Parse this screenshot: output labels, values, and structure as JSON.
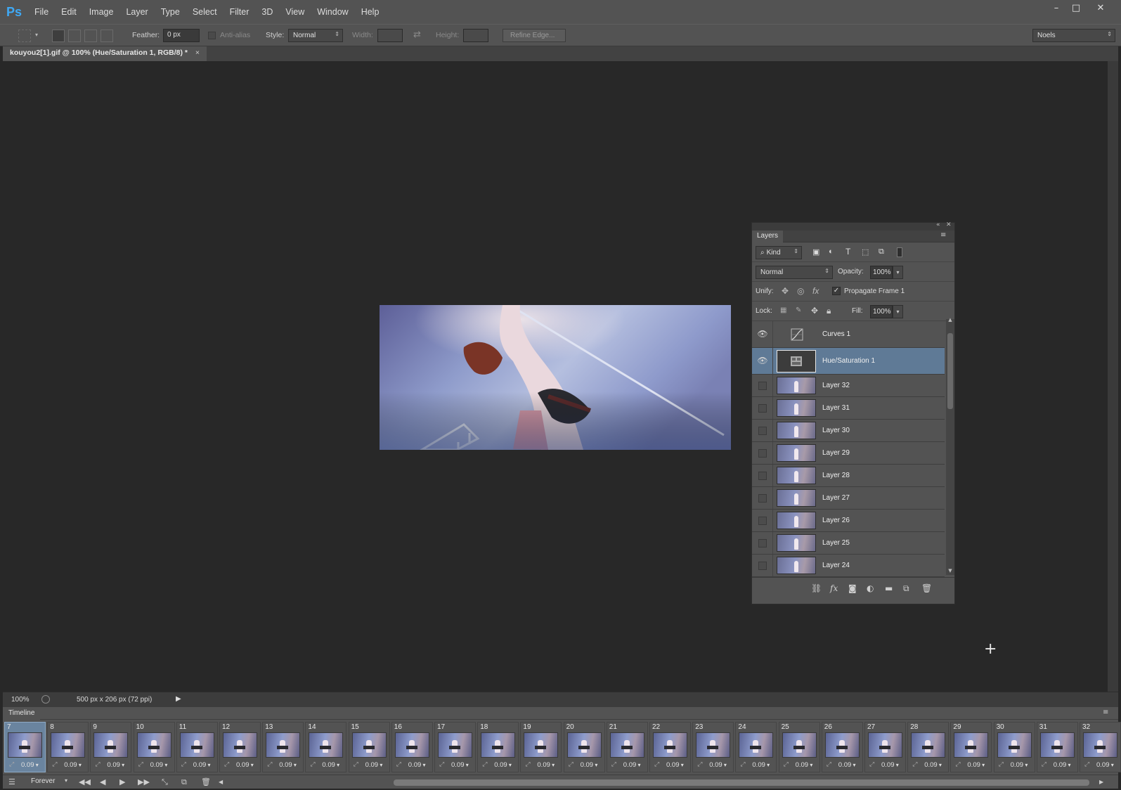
{
  "app": {
    "logo": "Ps"
  },
  "menu": [
    "File",
    "Edit",
    "Image",
    "Layer",
    "Type",
    "Select",
    "Filter",
    "3D",
    "View",
    "Window",
    "Help"
  ],
  "window_controls": {
    "minimize": "–",
    "maximize": "□",
    "close": "✕"
  },
  "options": {
    "feather_label": "Feather:",
    "feather_value": "0 px",
    "antialias_label": "Anti-alias",
    "style_label": "Style:",
    "style_value": "Normal",
    "width_label": "Width:",
    "height_label": "Height:",
    "refine_label": "Refine Edge...",
    "workspace_value": "Noels"
  },
  "document_tab": {
    "title": "kouyou2[1].gif @ 100% (Hue/Saturation 1, RGB/8) *",
    "close": "×"
  },
  "status": {
    "zoom": "100%",
    "doc_info": "500 px x 206 px (72 ppi)"
  },
  "layers_panel": {
    "tab": "Layers",
    "kind_label": "Kind",
    "blend_mode": "Normal",
    "opacity_label": "Opacity:",
    "opacity_value": "100%",
    "unify_label": "Unify:",
    "propagate_label": "Propagate Frame 1",
    "propagate_checked": true,
    "lock_label": "Lock:",
    "fill_label": "Fill:",
    "fill_value": "100%",
    "layers": [
      {
        "name": "Curves 1",
        "visible": true,
        "type": "curves-adjustment",
        "selected": false
      },
      {
        "name": "Hue/Saturation 1",
        "visible": true,
        "type": "hue-saturation-adjustment",
        "selected": true
      },
      {
        "name": "Layer 32",
        "visible": false,
        "type": "pixel",
        "selected": false
      },
      {
        "name": "Layer 31",
        "visible": false,
        "type": "pixel",
        "selected": false
      },
      {
        "name": "Layer 30",
        "visible": false,
        "type": "pixel",
        "selected": false
      },
      {
        "name": "Layer 29",
        "visible": false,
        "type": "pixel",
        "selected": false
      },
      {
        "name": "Layer 28",
        "visible": false,
        "type": "pixel",
        "selected": false
      },
      {
        "name": "Layer 27",
        "visible": false,
        "type": "pixel",
        "selected": false
      },
      {
        "name": "Layer 26",
        "visible": false,
        "type": "pixel",
        "selected": false
      },
      {
        "name": "Layer 25",
        "visible": false,
        "type": "pixel",
        "selected": false
      },
      {
        "name": "Layer 24",
        "visible": false,
        "type": "pixel",
        "selected": false
      }
    ]
  },
  "timeline": {
    "title": "Timeline",
    "loop_value": "Forever",
    "frames": [
      {
        "number": "7",
        "delay": "0.09",
        "selected": true
      },
      {
        "number": "8",
        "delay": "0.09"
      },
      {
        "number": "9",
        "delay": "0.09"
      },
      {
        "number": "10",
        "delay": "0.09"
      },
      {
        "number": "11",
        "delay": "0.09"
      },
      {
        "number": "12",
        "delay": "0.09"
      },
      {
        "number": "13",
        "delay": "0.09"
      },
      {
        "number": "14",
        "delay": "0.09"
      },
      {
        "number": "15",
        "delay": "0.09"
      },
      {
        "number": "16",
        "delay": "0.09"
      },
      {
        "number": "17",
        "delay": "0.09"
      },
      {
        "number": "18",
        "delay": "0.09"
      },
      {
        "number": "19",
        "delay": "0.09"
      },
      {
        "number": "20",
        "delay": "0.09"
      },
      {
        "number": "21",
        "delay": "0.09"
      },
      {
        "number": "22",
        "delay": "0.09"
      },
      {
        "number": "23",
        "delay": "0.09"
      },
      {
        "number": "24",
        "delay": "0.09"
      },
      {
        "number": "25",
        "delay": "0.09"
      },
      {
        "number": "26",
        "delay": "0.09"
      },
      {
        "number": "27",
        "delay": "0.09"
      },
      {
        "number": "28",
        "delay": "0.09"
      },
      {
        "number": "29",
        "delay": "0.09"
      },
      {
        "number": "30",
        "delay": "0.09"
      },
      {
        "number": "31",
        "delay": "0.09"
      },
      {
        "number": "32",
        "delay": "0.09"
      }
    ]
  },
  "colors": {
    "chrome": "#535353",
    "canvas_bg": "#282828",
    "selection": "#5f7a96",
    "ps_blue": "#3fa9f5"
  }
}
